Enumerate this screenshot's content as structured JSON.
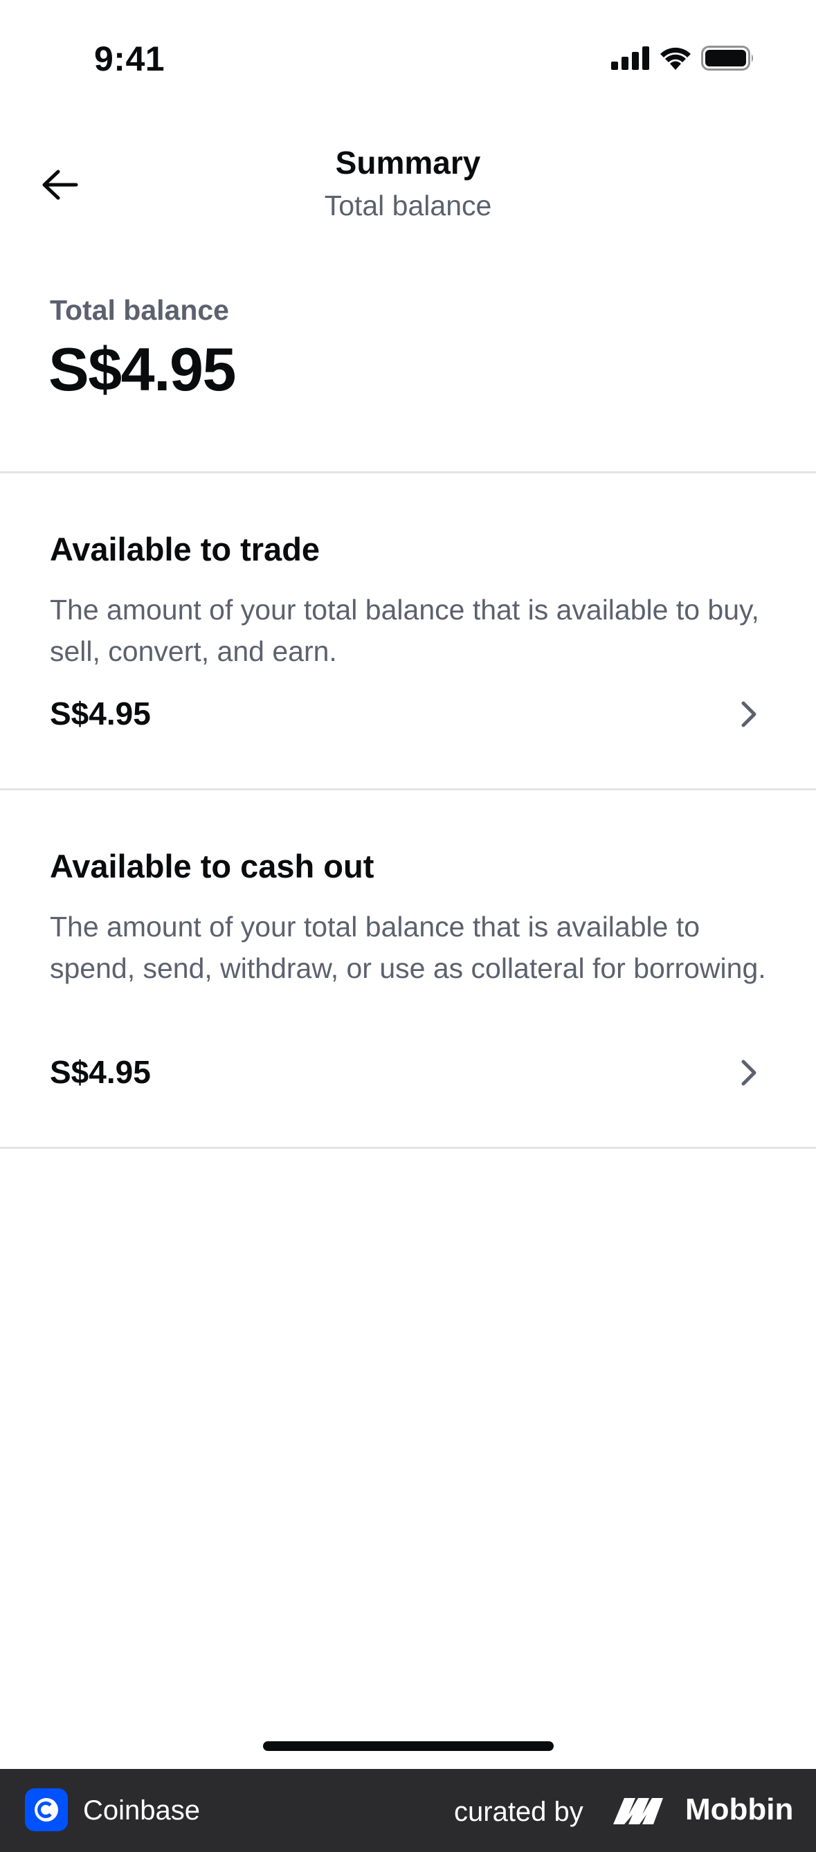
{
  "status_bar": {
    "time": "9:41"
  },
  "header": {
    "title": "Summary",
    "subtitle": "Total balance"
  },
  "total": {
    "label": "Total balance",
    "amount": "S$4.95"
  },
  "sections": [
    {
      "title": "Available to trade",
      "description": "The amount of your total balance that is available to buy, sell, convert, and earn.",
      "amount": "S$4.95"
    },
    {
      "title": "Available to cash out",
      "description": "The amount of your total balance that is available to spend, send, withdraw, or use as collateral for borrowing.",
      "amount": "S$4.95"
    }
  ],
  "footer": {
    "app_name": "Coinbase",
    "curated_by": "curated by",
    "brand": "Mobbin"
  },
  "icons": {
    "back": "arrow-left-icon",
    "chevron": "chevron-right-icon",
    "signal": "cellular-signal-icon",
    "wifi": "wifi-icon",
    "battery": "battery-icon",
    "app_logo": "coinbase-logo-icon",
    "brand_logo": "mobbin-logo-icon"
  },
  "colors": {
    "text_primary": "#0a0b0d",
    "text_secondary": "#5b616e",
    "divider": "#e3e4e8",
    "footer_bg": "#2b2b2d",
    "coinbase_blue": "#0052ff"
  }
}
